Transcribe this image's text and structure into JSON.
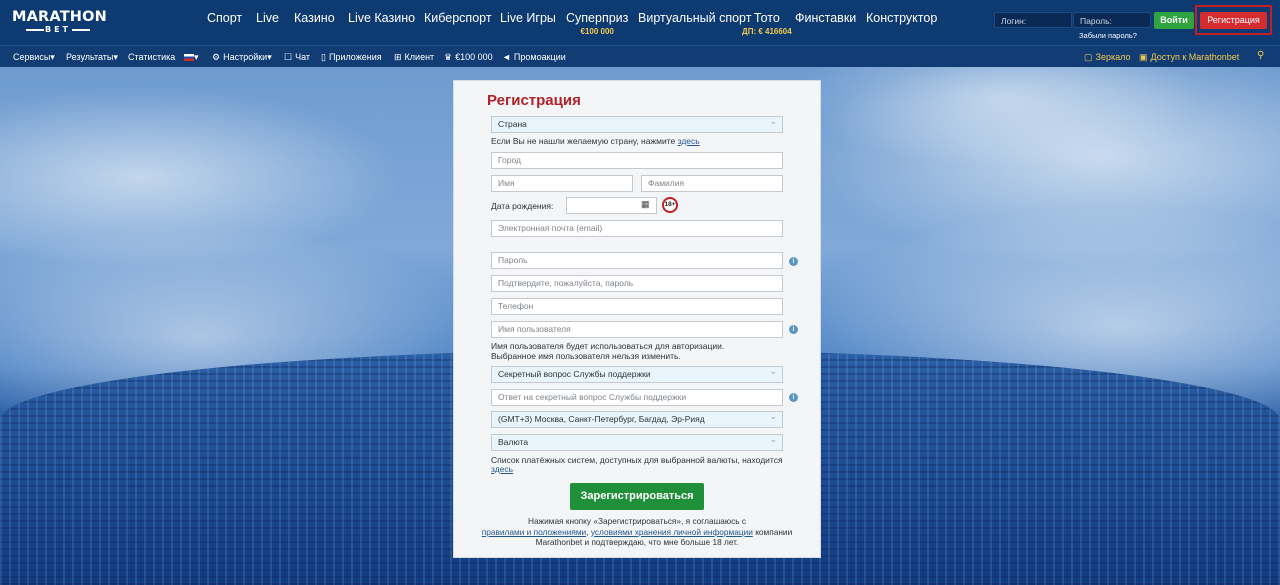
{
  "brand": {
    "line1": "MARATHON",
    "line2": "BET"
  },
  "nav": {
    "items": [
      {
        "label": "Спорт"
      },
      {
        "label": "Live"
      },
      {
        "label": "Казино"
      },
      {
        "label": "Live Казино"
      },
      {
        "label": "Киберспорт"
      },
      {
        "label": "Live Игры"
      },
      {
        "label": "Суперприз",
        "sub": "€100 000"
      },
      {
        "label": "Виртуальный спорт"
      },
      {
        "label": "Тото",
        "sub": "ДП: € 416604"
      },
      {
        "label": "Финставки"
      },
      {
        "label": "Конструктор"
      }
    ]
  },
  "auth": {
    "login_placeholder": "Логин:",
    "password_placeholder": "Пароль:",
    "login_button": "Войти",
    "register_button": "Регистрация",
    "forgot_password": "Забыли пароль?"
  },
  "subnav": {
    "services": "Сервисы",
    "results": "Результаты",
    "statistics": "Статистика",
    "settings": "Настройки",
    "chat": "Чат",
    "apps": "Приложения",
    "client": "Клиент",
    "prize": "€100 000",
    "promo": "Промоакции",
    "mirror": "Зеркало",
    "access": "Доступ к Marathonbet"
  },
  "form": {
    "title": "Регистрация",
    "country": "Страна",
    "country_hint": "Если Вы не нашли желаемую страну, нажмите",
    "country_hint_link": "здесь",
    "city": "Город",
    "first_name": "Имя",
    "last_name": "Фамилия",
    "birth_label": "Дата рождения:",
    "age_badge": "18+",
    "email": "Электронная почта (email)",
    "password": "Пароль",
    "password_confirm": "Подтвердите, пожалуйста, пароль",
    "phone": "Телефон",
    "username": "Имя пользователя",
    "username_hint_1": "Имя пользователя будет использоваться для авторизации.",
    "username_hint_2": "Выбранное имя пользователя нельзя изменить.",
    "secret_question": "Секретный вопрос Службы поддержки",
    "secret_answer": "Ответ на секретный вопрос Службы поддержки",
    "timezone": "(GMT+3) Москва, Санкт-Петербург, Багдад, Эр-Рияд",
    "currency": "Валюта",
    "currency_hint": "Список платёжных систем, доступных для выбранной валюты, находится",
    "currency_hint_link": "здесь",
    "submit": "Зарегистрироваться",
    "terms_1": "Нажимая кнопку «Зарегистрироваться», я соглашаюсь с",
    "terms_link1": "правилами и положениями",
    "terms_sep": ",",
    "terms_link2": "условиями хранения личной информации",
    "terms_2": "компании",
    "terms_3": "Marathonbet и подтверждаю, что мне больше 18 лет."
  }
}
